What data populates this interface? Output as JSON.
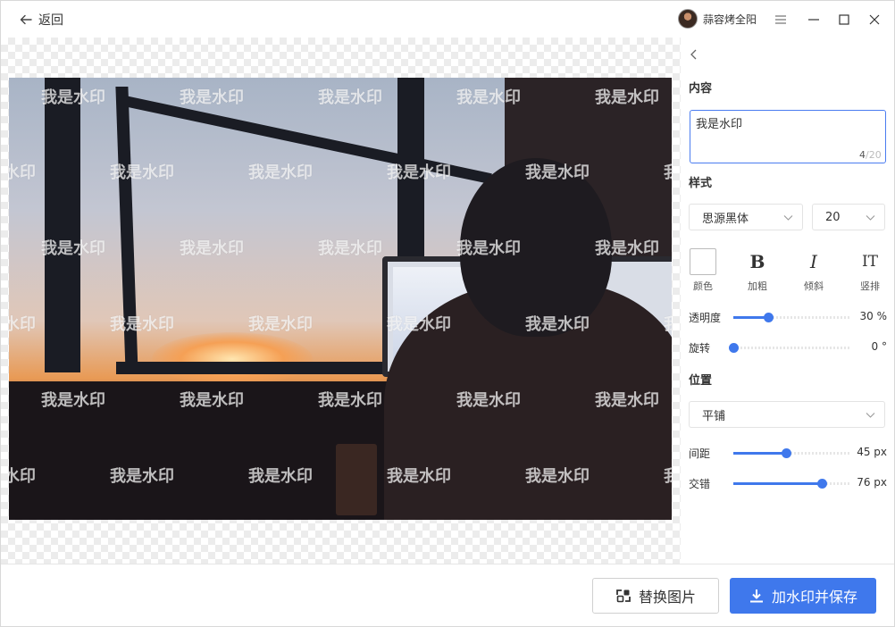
{
  "titlebar": {
    "back_label": "返回",
    "user_name": "蒜容烤全阳"
  },
  "canvas": {
    "watermark_text": "我是水印"
  },
  "panel": {
    "content_heading": "内容",
    "watermark_input_value": "我是水印",
    "char_count": "4",
    "char_max": "/20",
    "style_heading": "样式",
    "font_family": "思源黑体",
    "font_size": "20",
    "tools": [
      {
        "glyph": "",
        "label": "颜色"
      },
      {
        "glyph": "B",
        "label": "加粗"
      },
      {
        "glyph": "I",
        "label": "倾斜"
      },
      {
        "glyph": "ⅠT",
        "label": "竖排"
      }
    ],
    "opacity": {
      "label": "透明度",
      "value": 30,
      "display": "30 %"
    },
    "rotation": {
      "label": "旋转",
      "value": 0,
      "display": "0 °"
    },
    "position_heading": "位置",
    "layout_mode": "平铺",
    "spacing": {
      "label": "间距",
      "value": 45,
      "display": "45 px"
    },
    "stagger": {
      "label": "交错",
      "value": 76,
      "display": "76 px"
    }
  },
  "footer": {
    "replace_label": "替换图片",
    "save_label": "加水印并保存"
  },
  "colors": {
    "accent": "#3f78ec",
    "input_border": "#4a7cf0"
  }
}
